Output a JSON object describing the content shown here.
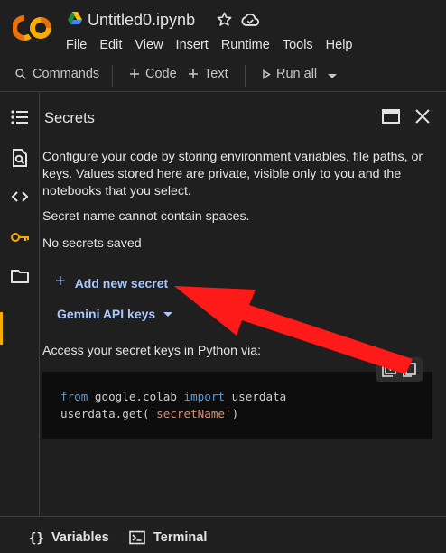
{
  "header": {
    "title": "Untitled0.ipynb",
    "menu": [
      "File",
      "Edit",
      "View",
      "Insert",
      "Runtime",
      "Tools",
      "Help"
    ]
  },
  "toolbar": {
    "commands_label": "Commands",
    "code_label": "Code",
    "text_label": "Text",
    "run_all_label": "Run all"
  },
  "sidebar": {
    "icons": [
      "table-of-contents-icon",
      "find-icon",
      "code-snippets-icon",
      "key-icon",
      "folder-icon"
    ],
    "active": "key-icon"
  },
  "panel": {
    "title": "Secrets",
    "description": "Configure your code by storing environment variables, file paths, or keys. Values stored here are private, visible only to you and the notebooks that you select.",
    "name_rule": "Secret name cannot contain spaces.",
    "empty_state": "No secrets saved",
    "add_secret_label": "Add new secret",
    "gemini_label": "Gemini API keys",
    "access_label": "Access your secret keys in Python via:",
    "code": {
      "line1_kw1": "from",
      "line1_mod": " google.colab ",
      "line1_kw2": "import",
      "line1_name": " userdata",
      "line2_call": "userdata.get(",
      "line2_str": "'secretName'",
      "line2_end": ")"
    }
  },
  "bottombar": {
    "variables_label": "Variables",
    "terminal_label": "Terminal"
  },
  "colors": {
    "background": "#1f1f1f",
    "accent_link": "#a8c7fa",
    "logo_orange": "#f9ab00",
    "annotation_arrow": "#ff1a1a"
  }
}
